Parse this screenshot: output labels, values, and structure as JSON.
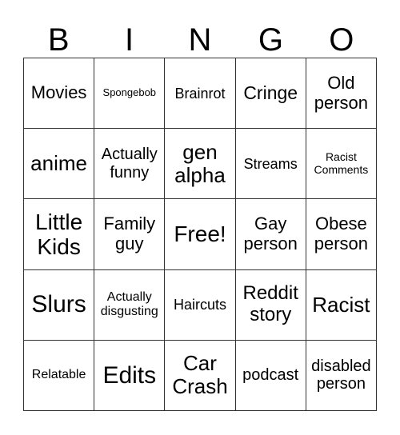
{
  "header": [
    "B",
    "I",
    "N",
    "G",
    "O"
  ],
  "cells": [
    [
      "Movies",
      "Spongebob",
      "Brainrot",
      "Cringe",
      "Old person"
    ],
    [
      "anime",
      "Actually funny",
      "gen alpha",
      "Streams",
      "Racist Comments"
    ],
    [
      "Little Kids",
      "Family guy",
      "Free!",
      "Gay person",
      "Obese person"
    ],
    [
      "Slurs",
      "Actually disgusting",
      "Haircuts",
      "Reddit story",
      "Racist"
    ],
    [
      "Relatable",
      "Edits",
      "Car Crash",
      "podcast",
      "disabled person"
    ]
  ]
}
